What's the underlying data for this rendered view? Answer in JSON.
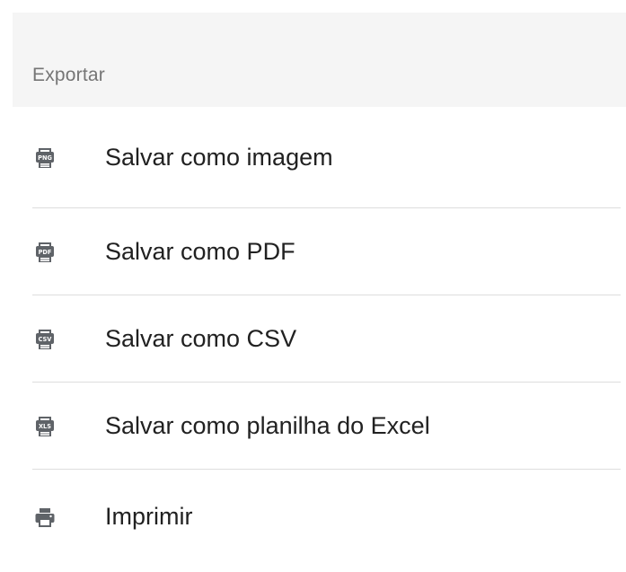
{
  "header": {
    "label": "Exportar"
  },
  "items": [
    {
      "label": "Salvar como imagem",
      "icon": "png-file-icon",
      "badge": "PNG"
    },
    {
      "label": "Salvar como PDF",
      "icon": "pdf-file-icon",
      "badge": "PDF"
    },
    {
      "label": "Salvar como CSV",
      "icon": "csv-file-icon",
      "badge": "CSV"
    },
    {
      "label": "Salvar como planilha do Excel",
      "icon": "xls-file-icon",
      "badge": "XLS"
    },
    {
      "label": "Imprimir",
      "icon": "printer-icon"
    }
  ],
  "colors": {
    "icon": "#5f6368",
    "text": "#212121",
    "header_text": "#757575",
    "header_bg": "#f5f5f5",
    "divider": "#dddddd"
  }
}
